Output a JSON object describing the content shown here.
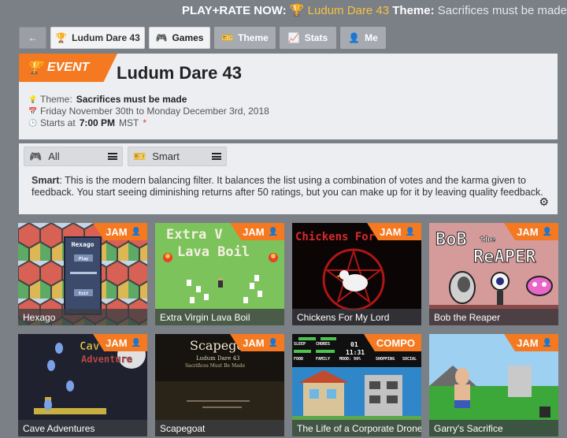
{
  "banner": {
    "prefix": "PLAY+RATE NOW:",
    "event": "Ludum Dare 43",
    "theme_label": "Theme:",
    "theme": "Sacrifices must be made"
  },
  "nav": {
    "back_label": "←",
    "event_label": "Ludum Dare 43",
    "games_label": "Games",
    "theme_label": "Theme",
    "stats_label": "Stats",
    "me_label": "Me"
  },
  "event": {
    "ribbon": "EVENT",
    "title": "Ludum Dare 43",
    "theme_prefix": "Theme:",
    "theme": "Sacrifices must be made",
    "dates": "Friday November 30th to Monday December 3rd, 2018",
    "starts_prefix": "Starts at",
    "start_time": "7:00 PM",
    "timezone": "MST",
    "asterisk": "*"
  },
  "filter": {
    "category": "All",
    "sort": "Smart",
    "desc_title": "Smart",
    "desc_text": ": This is the modern balancing filter. It balances the list using a combination of votes and the karma given to feedback. You start seeing diminishing returns after 50 ratings, but you can make up for it by leaving quality feedback."
  },
  "games": [
    {
      "title": "Hexago",
      "badge": "JAM"
    },
    {
      "title": "Extra Virgin Lava Boil",
      "badge": "JAM"
    },
    {
      "title": "Chickens For My Lord",
      "badge": "JAM"
    },
    {
      "title": "Bob the Reaper",
      "badge": "JAM"
    },
    {
      "title": "Cave Adventures",
      "badge": "JAM"
    },
    {
      "title": "Scapegoat",
      "badge": "JAM"
    },
    {
      "title": "The Life of a Corporate Drone",
      "badge": "COMPO"
    },
    {
      "title": "Garry's Sacrifice",
      "badge": "JAM"
    }
  ],
  "thumbs": {
    "hexago": {
      "title": "Hexago",
      "play": "Play",
      "exit": "Exit"
    },
    "lava": {
      "line1": "Extra V",
      "line2": "Lava Boil"
    },
    "chickens": {
      "line1": "Chickens For"
    },
    "bob": {
      "line1": "BoB",
      "line2": "the",
      "line3": "ReAPER"
    },
    "cave": {
      "line1": "Cav",
      "line2": "Adventure"
    },
    "scapegoat": {
      "title": "Scapego",
      "line2": "Ludum Dare 43",
      "line3": "Sacrifices Must Be Made"
    },
    "drone": {
      "sleep": "SLEEP",
      "chores": "CHORES",
      "day": "01",
      "clock": "11:31",
      "food": "FOOD",
      "family": "FAMILY",
      "mood": "MOOD: 96%",
      "shopping": "SHOPPING",
      "social": "SOCIAL"
    }
  },
  "colors": {
    "accent": "#f47920",
    "background": "#7b7f86",
    "panel": "#eceef1"
  }
}
